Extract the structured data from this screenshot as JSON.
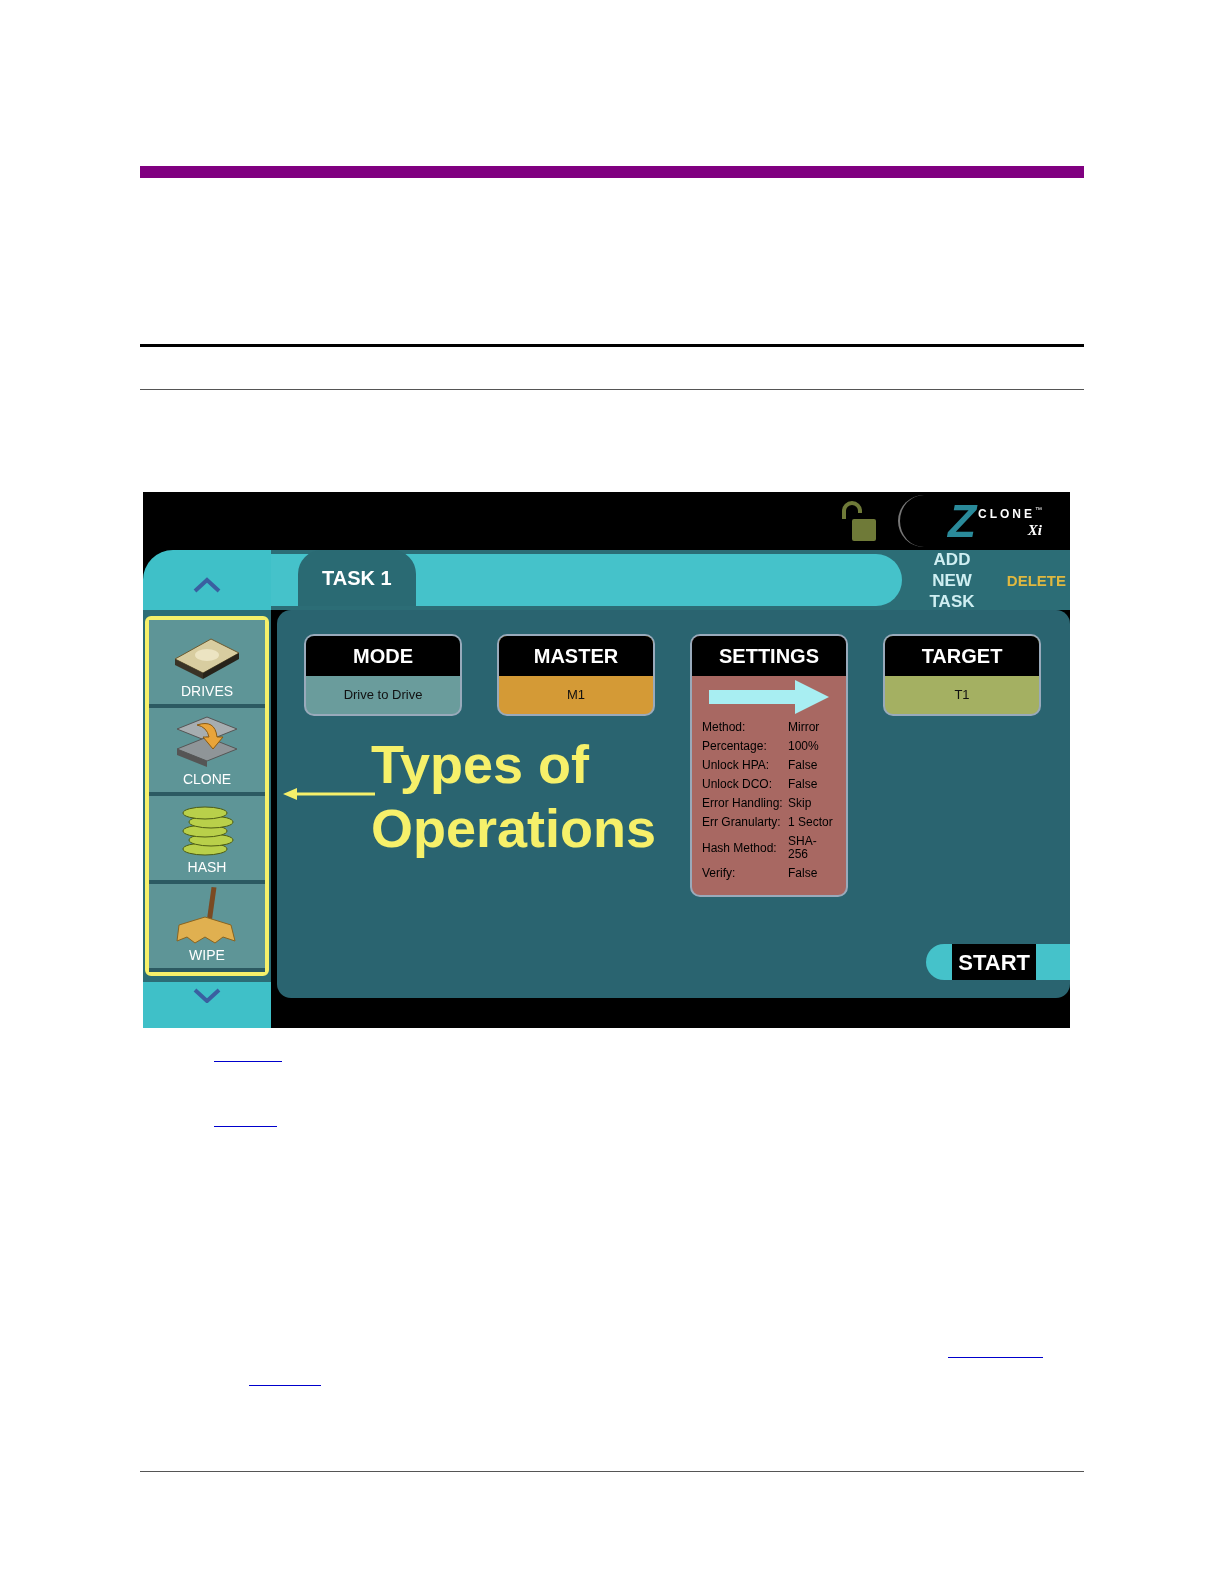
{
  "device_screen": {
    "header": {
      "locked": false,
      "logo_mark": "Z",
      "logo_word": "CLONE",
      "logo_tm": "™",
      "logo_suffix": "Xi"
    },
    "tabs": [
      {
        "label": "TASK 1",
        "selected": true
      }
    ],
    "actions": [
      {
        "label": "ADD NEW TASK",
        "kind": "add"
      },
      {
        "label": "DELETE",
        "kind": "delete"
      }
    ],
    "sidebar": {
      "highlighted": true,
      "items": [
        {
          "label": "DRIVES",
          "kind": "drives"
        },
        {
          "label": "CLONE",
          "kind": "clone"
        },
        {
          "label": "HASH",
          "kind": "hash"
        },
        {
          "label": "WIPE",
          "kind": "wipe"
        }
      ]
    },
    "cards": [
      {
        "title": "MODE",
        "value": "Drive to Drive",
        "color": "#6a9c9c"
      },
      {
        "title": "MASTER",
        "value": "M1",
        "color": "#d49a36"
      },
      {
        "title": "SETTINGS",
        "kind": "settings",
        "color": "#a86862",
        "rows": [
          {
            "label": "Method:",
            "value": "Mirror"
          },
          {
            "label": "Percentage:",
            "value": "100%"
          },
          {
            "label": "Unlock HPA:",
            "value": "False"
          },
          {
            "label": "Unlock DCO:",
            "value": "False"
          },
          {
            "label": "Error Handling:",
            "value": "Skip"
          },
          {
            "label": "Err Granularty:",
            "value": "1 Sector"
          },
          {
            "label": "Hash Method:",
            "value": "SHA-256"
          },
          {
            "label": "Verify:",
            "value": "False"
          }
        ]
      },
      {
        "title": "TARGET",
        "value": "T1",
        "color": "#a4b062"
      }
    ],
    "annotation": "Types of Operations",
    "start_button": "START"
  }
}
